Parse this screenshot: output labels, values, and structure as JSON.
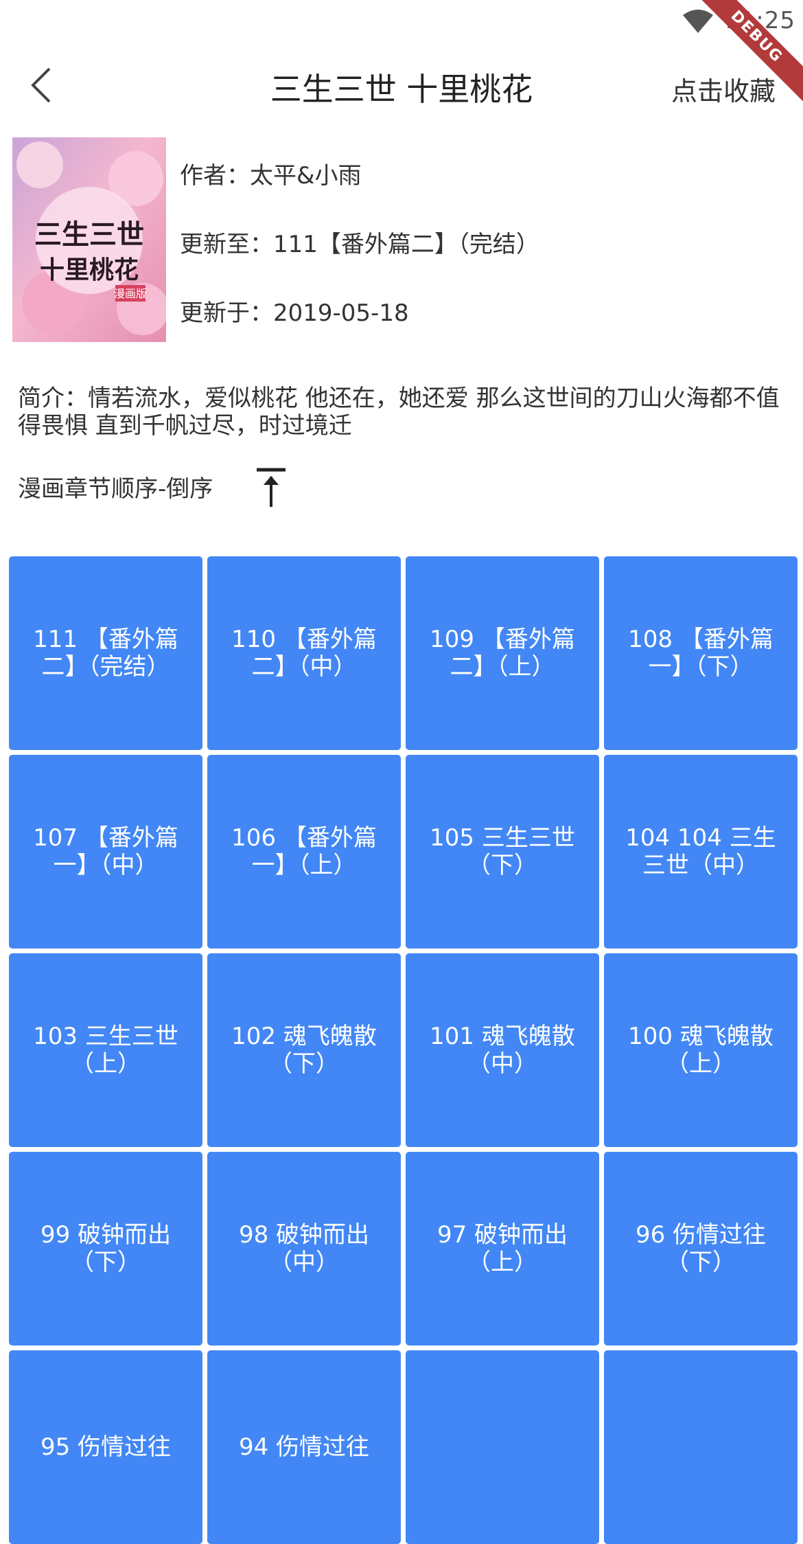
{
  "status_bar": {
    "time": "11:25",
    "debug_label": "DEBUG"
  },
  "app_bar": {
    "title": "三生三世 十里桃花",
    "favorite_label": "点击收藏",
    "back_icon": "chevron-left-icon"
  },
  "comic": {
    "cover_image": "三生三世 十里桃花 cover artwork",
    "cover_text": "三生三世 十里桃花 漫画版",
    "author": "作者：太平&小雨",
    "latest": "更新至：111【番外篇二】（完结）",
    "updated": "更新于：2019-05-18",
    "intro": "简介：情若流水，爱似桃花 他还在，她还爱 那么这世间的刀山火海都不值得畏惧 直到千帆过尽，时过境迁"
  },
  "chapter_order": {
    "label": "漫画章节顺序-倒序",
    "sort_icon": "arrow-up-to-line-icon"
  },
  "chapters": [
    "111 【番外篇二】（完结）",
    "110 【番外篇二】（中）",
    "109 【番外篇二】（上）",
    "108 【番外篇一】（下）",
    "107 【番外篇一】（中）",
    "106 【番外篇一】（上）",
    "105 三生三世（下）",
    "104 104 三生三世（中）",
    "103 三生三世（上）",
    "102 魂飞魄散（下）",
    "101 魂飞魄散（中）",
    "100 魂飞魄散（上）",
    "99 破钟而出（下）",
    "98 破钟而出（中）",
    "97 破钟而出（上）",
    "96 伤情过往（下）",
    "95 伤情过往",
    "94 伤情过往",
    "",
    ""
  ],
  "colors": {
    "tile": "#4287f5",
    "tile_text": "#ffffff",
    "debug_ribbon": "#b33a3a"
  }
}
